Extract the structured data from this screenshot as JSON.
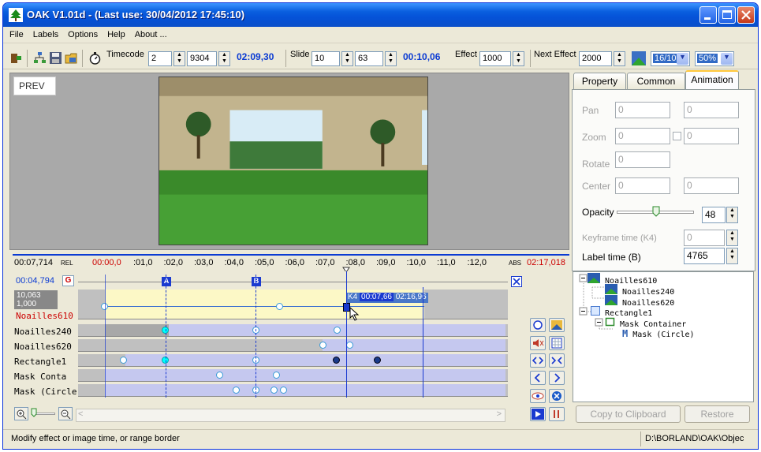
{
  "window": {
    "title": "OAK V1.01d - (Last use: 30/04/2012 17:45:10)"
  },
  "menu": [
    "File",
    "Labels",
    "Options",
    "Help",
    "About ..."
  ],
  "toolbar": {
    "timecode_label": "Timecode",
    "timecode_a": "2",
    "timecode_b": "9304",
    "timecode_time": "02:09,30",
    "slide_label": "Slide",
    "slide_a": "10",
    "slide_b": "63",
    "slide_time": "00:10,06",
    "effect_label": "Effect",
    "effect_value": "1000",
    "next_effect_label": "Next Effect",
    "next_effect_value": "2000",
    "aspect_value": "16/10",
    "zoom_value": "50%"
  },
  "preview": {
    "label": "PREV"
  },
  "tabs": [
    "Property",
    "Common",
    "Animation"
  ],
  "anim": {
    "pan_label": "Pan",
    "pan_a": "0",
    "pan_b": "0",
    "zoom_label": "Zoom",
    "zoom_a": "0",
    "zoom_b": "0",
    "rotate_label": "Rotate",
    "rotate_a": "0",
    "center_label": "Center",
    "center_a": "0",
    "center_b": "0",
    "opacity_label": "Opacity",
    "opacity_value": "48",
    "keyframe_label": "Keyframe time (K4)",
    "keyframe_value": "0",
    "labeltime_label": "Label time (B)",
    "labeltime_value": "4765"
  },
  "tree": {
    "n1": "Noailles610",
    "n2": "Noailles240",
    "n3": "Noailles620",
    "n4": "Rectangle1",
    "n5": "Mask Container",
    "n6": "Mask (Circle)"
  },
  "buttons": {
    "copy": "Copy to Clipboard",
    "restore": "Restore"
  },
  "timeline": {
    "left_time": "00:07,714",
    "rel": "REL",
    "ruler_start": "00:00,0",
    "ticks": [
      ":01,0",
      ":02,0",
      ":03,0",
      ":04,0",
      ":05,0",
      ":06,0",
      ":07,0",
      ":08,0",
      ":09,0",
      ":10,0",
      ":11,0",
      ":12,0"
    ],
    "abs": "ABS",
    "abs_time": "02:17,018",
    "cursor_time": "00:04,794",
    "marker_a": "A",
    "marker_b": "B",
    "sel_top": "10,063",
    "sel_bottom": "1,000",
    "tooltip_k": "K4",
    "tooltip_t1": "00:07,66",
    "tooltip_t2": "02:16,96",
    "tracks": [
      "Noailles610",
      "Noailles240",
      "Noailles620",
      "Rectangle1",
      "Mask Conta",
      "Mask (Circle"
    ]
  },
  "status": {
    "left": "Modify effect or image time, or range border",
    "right": "D:\\BORLAND\\OAK\\Objec"
  }
}
